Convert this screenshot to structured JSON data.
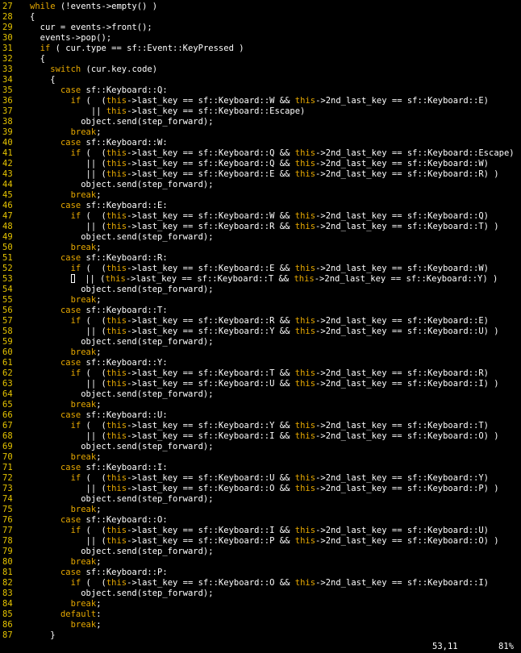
{
  "editor": {
    "lines": [
      {
        "n": "27",
        "t": "while (!events->empty() )"
      },
      {
        "n": "28",
        "t": "{"
      },
      {
        "n": "29",
        "t": "  cur = events->front();"
      },
      {
        "n": "30",
        "t": "  events->pop();"
      },
      {
        "n": "31",
        "t": "  if ( cur.type == sf::Event::KeyPressed )"
      },
      {
        "n": "32",
        "t": "  {"
      },
      {
        "n": "33",
        "t": "    switch (cur.key.code)"
      },
      {
        "n": "34",
        "t": "    {"
      },
      {
        "n": "35",
        "t": "      case sf::Keyboard::Q:"
      },
      {
        "n": "36",
        "t": "        if (  (this->last_key == sf::Keyboard::W && this->2nd_last_key == sf::Keyboard::E)"
      },
      {
        "n": "37",
        "t": "            || this->last_key == sf::Keyboard::Escape)"
      },
      {
        "n": "38",
        "t": "          object.send(step_forward);"
      },
      {
        "n": "39",
        "t": "        break;"
      },
      {
        "n": "40",
        "t": "      case sf::Keyboard::W:"
      },
      {
        "n": "41",
        "t": "        if (  (this->last_key == sf::Keyboard::Q && this->2nd_last_key == sf::Keyboard::Escape)"
      },
      {
        "n": "42",
        "t": "           || (this->last_key == sf::Keyboard::Q && this->2nd_last_key == sf::Keyboard::W)"
      },
      {
        "n": "43",
        "t": "           || (this->last_key == sf::Keyboard::E && this->2nd_last_key == sf::Keyboard::R) )"
      },
      {
        "n": "44",
        "t": "          object.send(step_forward);"
      },
      {
        "n": "45",
        "t": "        break;"
      },
      {
        "n": "46",
        "t": "      case sf::Keyboard::E:"
      },
      {
        "n": "47",
        "t": "        if (  (this->last_key == sf::Keyboard::W && this->2nd_last_key == sf::Keyboard::Q)"
      },
      {
        "n": "48",
        "t": "           || (this->last_key == sf::Keyboard::R && this->2nd_last_key == sf::Keyboard::T) )"
      },
      {
        "n": "49",
        "t": "          object.send(step_forward);"
      },
      {
        "n": "50",
        "t": "        break;"
      },
      {
        "n": "51",
        "t": "      case sf::Keyboard::R:"
      },
      {
        "n": "52",
        "t": "        if (  (this->last_key == sf::Keyboard::E && this->2nd_last_key == sf::Keyboard::W)"
      },
      {
        "n": "53",
        "t": "        █  || (this->last_key == sf::Keyboard::T && this->2nd_last_key == sf::Keyboard::Y) )"
      },
      {
        "n": "54",
        "t": "          object.send(step_forward);"
      },
      {
        "n": "55",
        "t": "        break;"
      },
      {
        "n": "56",
        "t": "      case sf::Keyboard::T:"
      },
      {
        "n": "57",
        "t": "        if (  (this->last_key == sf::Keyboard::R && this->2nd_last_key == sf::Keyboard::E)"
      },
      {
        "n": "58",
        "t": "           || (this->last_key == sf::Keyboard::Y && this->2nd_last_key == sf::Keyboard::U) )"
      },
      {
        "n": "59",
        "t": "          object.send(step_forward);"
      },
      {
        "n": "60",
        "t": "        break;"
      },
      {
        "n": "61",
        "t": "      case sf::Keyboard::Y:"
      },
      {
        "n": "62",
        "t": "        if (  (this->last_key == sf::Keyboard::T && this->2nd_last_key == sf::Keyboard::R)"
      },
      {
        "n": "63",
        "t": "           || (this->last_key == sf::Keyboard::U && this->2nd_last_key == sf::Keyboard::I) )"
      },
      {
        "n": "64",
        "t": "          object.send(step_forward);"
      },
      {
        "n": "65",
        "t": "        break;"
      },
      {
        "n": "66",
        "t": "      case sf::Keyboard::U:"
      },
      {
        "n": "67",
        "t": "        if (  (this->last_key == sf::Keyboard::Y && this->2nd_last_key == sf::Keyboard::T)"
      },
      {
        "n": "68",
        "t": "           || (this->last_key == sf::Keyboard::I && this->2nd_last_key == sf::Keyboard::O) )"
      },
      {
        "n": "69",
        "t": "          object.send(step_forward);"
      },
      {
        "n": "70",
        "t": "        break;"
      },
      {
        "n": "71",
        "t": "      case sf::Keyboard::I:"
      },
      {
        "n": "72",
        "t": "        if (  (this->last_key == sf::Keyboard::U && this->2nd_last_key == sf::Keyboard::Y)"
      },
      {
        "n": "73",
        "t": "           || (this->last_key == sf::Keyboard::O && this->2nd_last_key == sf::Keyboard::P) )"
      },
      {
        "n": "74",
        "t": "          object.send(step_forward);"
      },
      {
        "n": "75",
        "t": "        break;"
      },
      {
        "n": "76",
        "t": "      case sf::Keyboard::O:"
      },
      {
        "n": "77",
        "t": "        if (  (this->last_key == sf::Keyboard::I && this->2nd_last_key == sf::Keyboard::U)"
      },
      {
        "n": "78",
        "t": "           || (this->last_key == sf::Keyboard::P && this->2nd_last_key == sf::Keyboard::O) )"
      },
      {
        "n": "79",
        "t": "          object.send(step_forward);"
      },
      {
        "n": "80",
        "t": "        break;"
      },
      {
        "n": "81",
        "t": "      case sf::Keyboard::P:"
      },
      {
        "n": "82",
        "t": "        if (  (this->last_key == sf::Keyboard::O && this->2nd_last_key == sf::Keyboard::I)"
      },
      {
        "n": "83",
        "t": "          object.send(step_forward);"
      },
      {
        "n": "84",
        "t": "        break;"
      },
      {
        "n": "85",
        "t": "      default:"
      },
      {
        "n": "86",
        "t": "        break;"
      },
      {
        "n": "87",
        "t": "    }"
      }
    ]
  },
  "status": {
    "position": "53,11",
    "percent": "81%"
  },
  "colors": {
    "background": "#000000",
    "text": "#ffffff",
    "line_number": "#e6c400",
    "keyword": "#e6a800"
  }
}
